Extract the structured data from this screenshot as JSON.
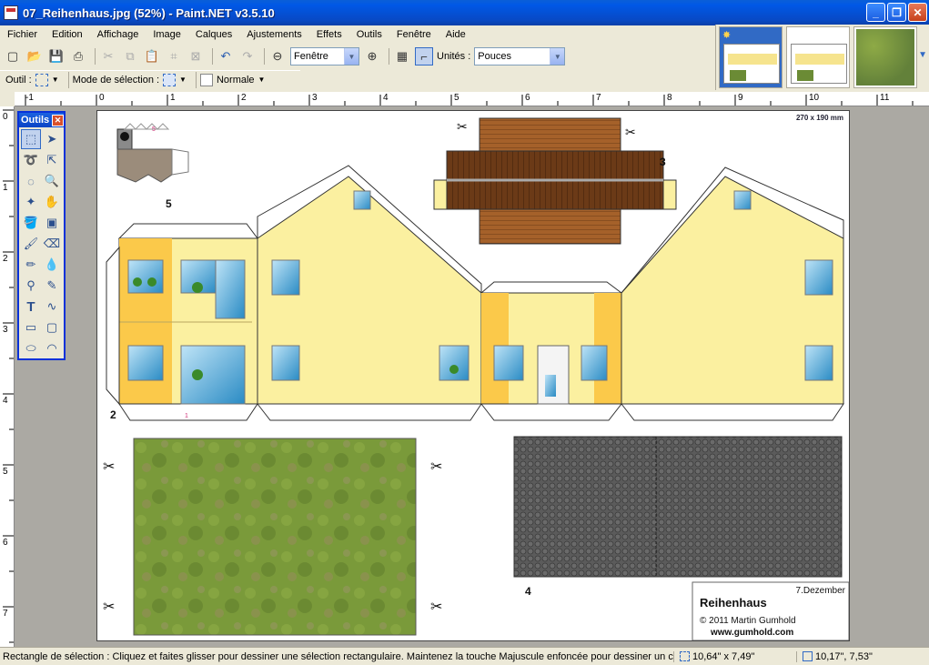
{
  "window": {
    "title": "07_Reihenhaus.jpg (52%) - Paint.NET v3.5.10",
    "minimize": "_",
    "restore": "❐",
    "close": "✕"
  },
  "menu": [
    "Fichier",
    "Edition",
    "Affichage",
    "Image",
    "Calques",
    "Ajustements",
    "Effets",
    "Outils",
    "Fenêtre",
    "Aide"
  ],
  "toolbar": {
    "zoom_value": "Fenêtre",
    "units_label": "Unités :",
    "units_value": "Pouces"
  },
  "toolbar2": {
    "tool_label": "Outil :",
    "selection_mode_label": "Mode de sélection :",
    "blend_mode_value": "Normale"
  },
  "tools_window": {
    "title": "Outils"
  },
  "ruler_h": [
    "-1",
    "0",
    "1",
    "2",
    "3",
    "4",
    "5",
    "6",
    "7",
    "8",
    "9",
    "10",
    "11"
  ],
  "ruler_v": [
    "0",
    "1",
    "2",
    "3",
    "4",
    "5",
    "6",
    "7"
  ],
  "image": {
    "size_label": "270 x 190 mm",
    "house_label": "Reihenhaus",
    "date_label": "7.Dezember",
    "copyright": "© 2011 Martin Gumhold",
    "website": "www.gumhold.com",
    "part_numbers": [
      "1",
      "2",
      "3",
      "4",
      "5"
    ]
  },
  "status": {
    "message": "Rectangle de sélection : Cliquez et faites glisser pour dessiner une sélection rectangulaire. Maintenez la touche Majuscule enfoncée pour dessiner un carr",
    "selection_size": "10,64\" x 7,49\"",
    "cursor_position": "10,17\", 7,53\""
  },
  "colors": {
    "wall_yellow": "#fbf0a0",
    "accent_orange": "#fbc94a",
    "roof_brown": "#6b3a17",
    "grass_green": "#7a9a3a",
    "paving_gray": "#5b5b5b",
    "fold_pink": "#d0347a"
  }
}
